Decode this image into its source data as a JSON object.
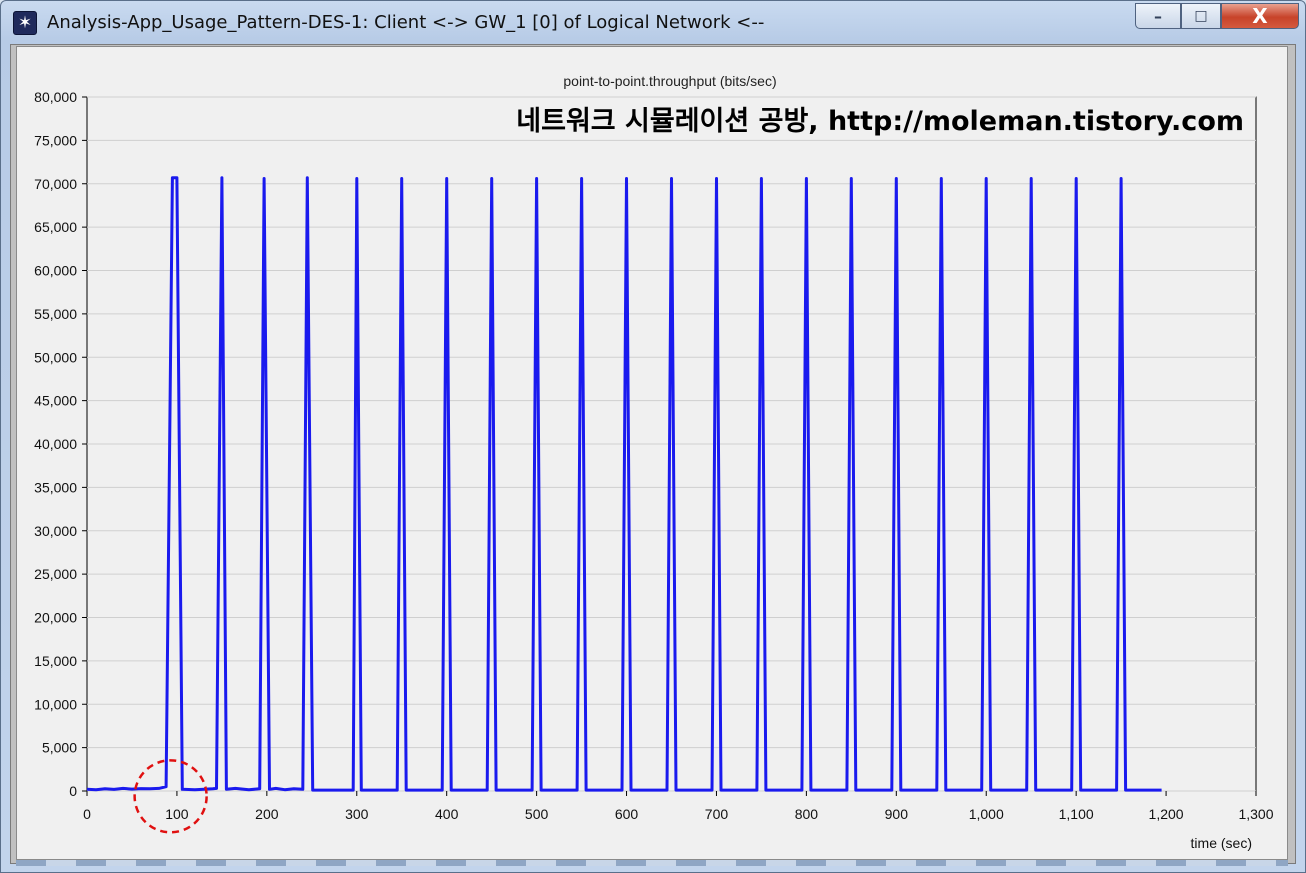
{
  "window": {
    "title": "Analysis-App_Usage_Pattern-DES-1: Client <-> GW_1 [0] of Logical Network <--",
    "app_icon": "star-burst-icon",
    "minimize_glyph": "–",
    "maximize_glyph": "□",
    "close_glyph": "X"
  },
  "watermark": "네트워크 시뮬레이션 공방, http://moleman.tistory.com",
  "chart_data": {
    "type": "line",
    "title": "point-to-point.throughput (bits/sec)",
    "xlabel": "time (sec)",
    "ylabel": "",
    "xlim": [
      0,
      1300
    ],
    "ylim": [
      0,
      80000
    ],
    "x_ticks": [
      0,
      100,
      200,
      300,
      400,
      500,
      600,
      700,
      800,
      900,
      1000,
      1100,
      1200,
      1300
    ],
    "x_tick_labels": [
      "0",
      "100",
      "200",
      "300",
      "400",
      "500",
      "600",
      "700",
      "800",
      "900",
      "1,000",
      "1,100",
      "1,200",
      "1,300"
    ],
    "y_ticks": [
      0,
      5000,
      10000,
      15000,
      20000,
      25000,
      30000,
      35000,
      40000,
      45000,
      50000,
      55000,
      60000,
      65000,
      70000,
      75000,
      80000
    ],
    "y_tick_labels": [
      "0",
      "5,000",
      "10,000",
      "15,000",
      "20,000",
      "25,000",
      "30,000",
      "35,000",
      "40,000",
      "45,000",
      "50,000",
      "55,000",
      "60,000",
      "65,000",
      "70,000",
      "75,000",
      "80,000"
    ],
    "grid": true,
    "line_color": "#1a1aee",
    "highlight": {
      "shape": "dashed circle",
      "color": "#e01010",
      "center_x": 93,
      "center_y": 1000
    },
    "series": [
      {
        "x": [
          0,
          10,
          20,
          30,
          40,
          50,
          60,
          70,
          80,
          88,
          95,
          100,
          106,
          120,
          140,
          144,
          150,
          155,
          165,
          180,
          192,
          197,
          203,
          210,
          220,
          230,
          240,
          245,
          251,
          296,
          300,
          305,
          345,
          350,
          355,
          395,
          400,
          405,
          445,
          450,
          455,
          495,
          500,
          505,
          545,
          550,
          555,
          595,
          600,
          605,
          645,
          650,
          655,
          695,
          700,
          705,
          745,
          750,
          755,
          795,
          800,
          805,
          845,
          850,
          855,
          895,
          900,
          905,
          945,
          950,
          955,
          995,
          1000,
          1005,
          1045,
          1050,
          1055,
          1095,
          1100,
          1105,
          1145,
          1150,
          1155,
          1195
        ],
        "y": [
          200,
          150,
          250,
          180,
          300,
          220,
          280,
          250,
          300,
          500,
          70700,
          70700,
          200,
          150,
          250,
          300,
          70700,
          200,
          300,
          150,
          250,
          70600,
          200,
          300,
          150,
          250,
          200,
          70700,
          100,
          100,
          70600,
          100,
          100,
          70600,
          100,
          100,
          70600,
          100,
          100,
          70600,
          100,
          100,
          70600,
          100,
          100,
          70600,
          100,
          100,
          70600,
          100,
          100,
          70600,
          100,
          100,
          70600,
          100,
          100,
          70600,
          100,
          100,
          70600,
          100,
          100,
          70600,
          100,
          100,
          70600,
          100,
          100,
          70600,
          100,
          100,
          70600,
          100,
          100,
          70600,
          100,
          100,
          70600,
          100,
          100,
          70600,
          100,
          100
        ]
      }
    ]
  }
}
